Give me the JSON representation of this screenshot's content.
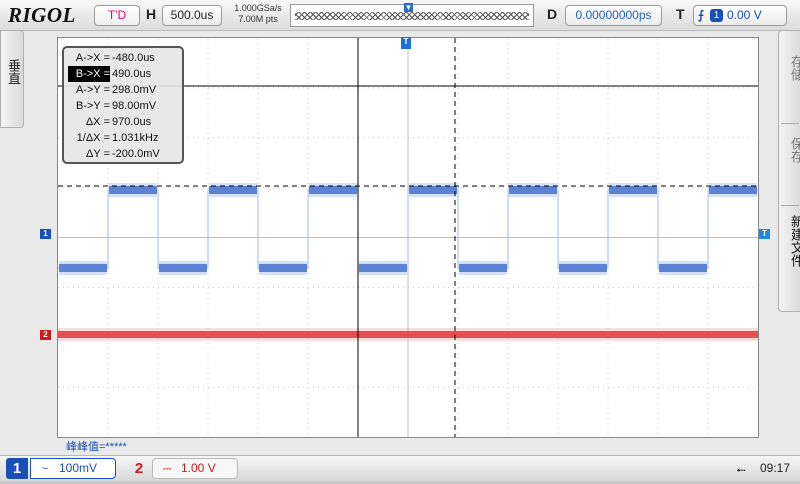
{
  "header": {
    "brand": "RIGOL",
    "run_status": "T'D",
    "horizontal_label": "H",
    "timebase": "500.0us",
    "sample_rate": "1.000GSa/s",
    "memory_depth": "7.00M pts",
    "delay_label": "D",
    "delay_value": "0.00000000ps",
    "trigger_label": "T",
    "trigger_edge_icon": "rising-edge-icon",
    "trigger_channel": "1",
    "trigger_level": "0.00 V"
  },
  "left_menu": {
    "label": "垂直"
  },
  "right_menu": {
    "items": [
      "存储",
      "保存",
      "新建文件"
    ]
  },
  "measurements": [
    {
      "label": "A->X",
      "value": "-480.0us"
    },
    {
      "label": "B->X",
      "value": "490.0us",
      "selected": true
    },
    {
      "label": "A->Y",
      "value": "298.0mV"
    },
    {
      "label": "B->Y",
      "value": "98.00mV"
    },
    {
      "label": "ΔX",
      "value": "970.0us"
    },
    {
      "label": "1/ΔX",
      "value": "1.031kHz"
    },
    {
      "label": "ΔY",
      "value": "-200.0mV"
    }
  ],
  "peak_to_peak": "峰峰值=*****",
  "markers": {
    "ch1": "1",
    "ch2": "2",
    "trigger": "T"
  },
  "footer": {
    "ch1_number": "1",
    "ch1_coupling": "~",
    "ch1_scale": "100mV",
    "ch2_number": "2",
    "ch2_coupling": "⎓",
    "ch2_scale": "1.00 V",
    "usb_icon": "usb-icon",
    "time": "09:17"
  },
  "colors": {
    "ch1": "#1a4fb8",
    "ch2": "#d11a1a",
    "accent": "#1e6fd0"
  }
}
